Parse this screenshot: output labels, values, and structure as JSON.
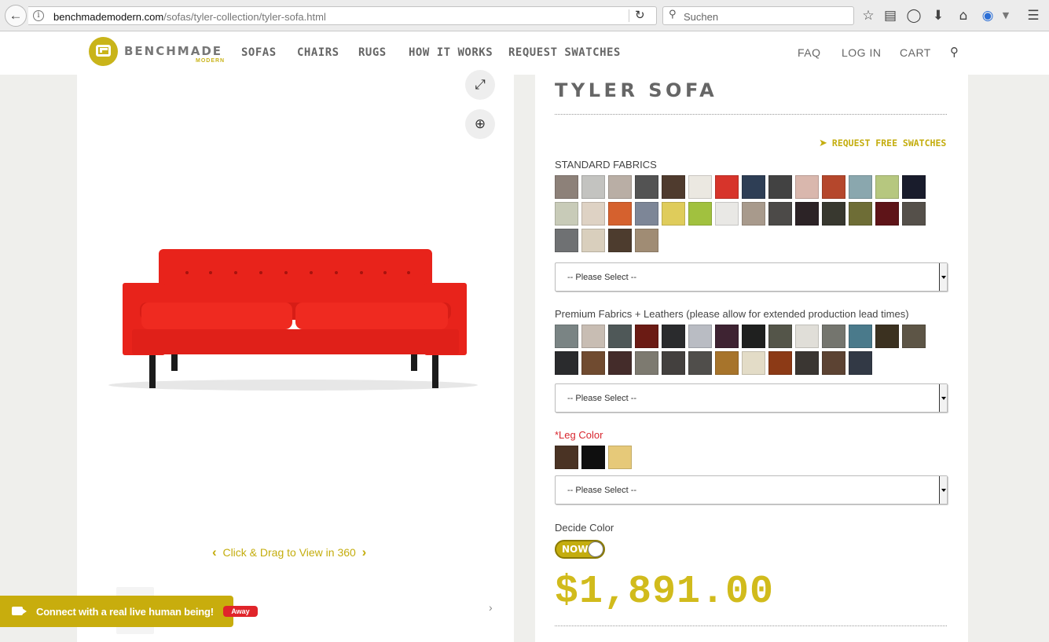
{
  "browser": {
    "url_host": "benchmademodern.com",
    "url_path": "/sofas/tyler-collection/tyler-sofa.html",
    "search_placeholder": "Suchen",
    "icons": [
      "back-arrow-icon",
      "info-icon",
      "reload-icon",
      "search-icon",
      "bookmark-star-icon",
      "reading-list-icon",
      "pocket-icon",
      "download-icon",
      "home-icon",
      "extension-icon",
      "menu-icon"
    ]
  },
  "header": {
    "logo_text": "BENCHMADE",
    "logo_sub": "MODERN",
    "nav": [
      "SOFAS",
      "CHAIRS",
      "RUGS",
      "HOW IT WORKS",
      "REQUEST SWATCHES"
    ],
    "nav_right": [
      "FAQ",
      "LOG IN",
      "CART"
    ]
  },
  "gallery": {
    "drag_hint": "Click & Drag to View in 360",
    "sofa_color": "#e8231b"
  },
  "chat": {
    "text": "Connect with a real live human being!",
    "status": "Away"
  },
  "product": {
    "title": "TYLER SOFA",
    "request_swatches": "REQUEST FREE SWATCHES",
    "standard_label": "STANDARD FABRICS",
    "standard_swatches": [
      "#8d8179",
      "#c3c3c0",
      "#b9aea5",
      "#535353",
      "#4f3b2e",
      "#ebe8e1",
      "#d7342b",
      "#2e3e55",
      "#424242",
      "#d9b7ad",
      "#b5472c",
      "#8aa7ae",
      "#b6c77f",
      "#191c2c",
      "#c8cbb8",
      "#ded2c4",
      "#d5612e",
      "#7d8697",
      "#dfcc5b",
      "#a1c13f",
      "#e9e8e5",
      "#a89a8c",
      "#4c4a48",
      "#2c2326",
      "#38382f",
      "#6e6d36",
      "#5e1418",
      "#55504a",
      "#6f7173",
      "#d9cfbd",
      "#4d3c2e",
      "#a08c74"
    ],
    "premium_label": "Premium Fabrics + Leathers (please allow for extended production lead times)",
    "premium_swatches": [
      "#7a8484",
      "#c8bdb3",
      "#4f5858",
      "#6b1b14",
      "#2a2b2d",
      "#b9bcc3",
      "#3e2332",
      "#1f201f",
      "#545549",
      "#e0ded8",
      "#74756e",
      "#4a7a8b",
      "#3b3120",
      "#5d5546",
      "#2a2b2d",
      "#704b30",
      "#442c2a",
      "#7d7a70",
      "#43403e",
      "#504e4b",
      "#a7742b",
      "#e3dcc7",
      "#8c3a16",
      "#3a3632",
      "#5c4333",
      "#323945"
    ],
    "leg_label": "*Leg Color",
    "leg_swatches": [
      "#4a3324",
      "#0f0f0f",
      "#e6c979"
    ],
    "select_placeholder": "-- Please Select --",
    "decide_label": "Decide Color",
    "toggle_label": "NOW",
    "price": "$1,891.00"
  }
}
